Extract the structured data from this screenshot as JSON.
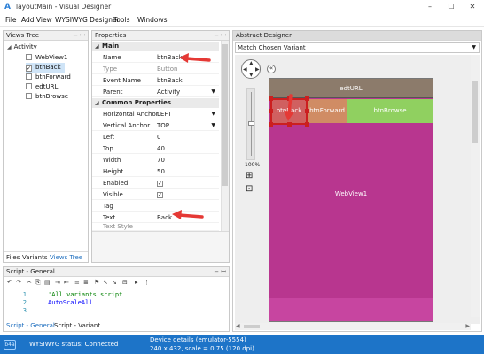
{
  "window": {
    "title": "layoutMain - Visual Designer",
    "app_icon": "a-letter-icon",
    "controls": [
      "–",
      "☐",
      "✕"
    ]
  },
  "menu": {
    "items": [
      "File",
      "Add View",
      "WYSIWYG Designer",
      "Tools",
      "Windows"
    ]
  },
  "views_tree": {
    "title": "Views Tree",
    "root": "Activity",
    "items": [
      {
        "label": "WebView1",
        "checked": false
      },
      {
        "label": "btnBack",
        "checked": true
      },
      {
        "label": "btnForward",
        "checked": false
      },
      {
        "label": "edtURL",
        "checked": false
      },
      {
        "label": "btnBrowse",
        "checked": false
      }
    ],
    "tabs": [
      "Files",
      "Variants",
      "Views Tree"
    ],
    "active_tab": "Views Tree"
  },
  "properties": {
    "title": "Properties",
    "main_section": "Main",
    "main_rows": [
      {
        "key": "Name",
        "value": "btnBack",
        "grey": false,
        "dropdown": false
      },
      {
        "key": "Type",
        "value": "Button",
        "grey": true,
        "dropdown": false
      },
      {
        "key": "Event Name",
        "value": "btnBack",
        "grey": false,
        "dropdown": false
      },
      {
        "key": "Parent",
        "value": "Activity",
        "grey": false,
        "dropdown": true
      }
    ],
    "common_section": "Common Properties",
    "common_rows": [
      {
        "key": "Horizontal Anchor",
        "value": "LEFT",
        "dropdown": true
      },
      {
        "key": "Vertical Anchor",
        "value": "TOP",
        "dropdown": true
      },
      {
        "key": "Left",
        "value": "0"
      },
      {
        "key": "Top",
        "value": "40"
      },
      {
        "key": "Width",
        "value": "70"
      },
      {
        "key": "Height",
        "value": "50"
      },
      {
        "key": "Enabled",
        "value": "✓",
        "checkbox": true
      },
      {
        "key": "Visible",
        "value": "✓",
        "checkbox": true
      },
      {
        "key": "Tag",
        "value": ""
      },
      {
        "key": "Text",
        "value": "Back"
      }
    ],
    "cut_row": "Text Style"
  },
  "script": {
    "title": "Script - General",
    "lines": [
      {
        "num": "1",
        "text": "'All variants script",
        "color": "#008000"
      },
      {
        "num": "2",
        "text": "AutoScaleAll",
        "color": "#0000ff"
      },
      {
        "num": "3",
        "text": "",
        "color": "#000000"
      }
    ],
    "tabs": [
      "Script - General",
      "Script - Variant"
    ],
    "active_tab": "Script - General"
  },
  "designer": {
    "title": "Abstract Designer",
    "variant_select": "Match Chosen Variant",
    "zoom": "100%",
    "views": {
      "edt": "edtURL",
      "back": "btnBack",
      "forward": "btnForward",
      "browse": "btnBrowse",
      "web": "WebView1"
    },
    "colors": {
      "edt": "#8c7b6b",
      "back": "#d06060",
      "forward": "#d08c64",
      "browse": "#90d060",
      "web": "#b8368f",
      "selection": "#cc1f1f"
    }
  },
  "status": {
    "logo": "b4a-logo-icon",
    "wysiwyg": "WYSIWYG status: Connected",
    "device": "Device details (emulator-5554)",
    "scale": "240 x 432, scale = 0.75 (120 dpi)"
  }
}
